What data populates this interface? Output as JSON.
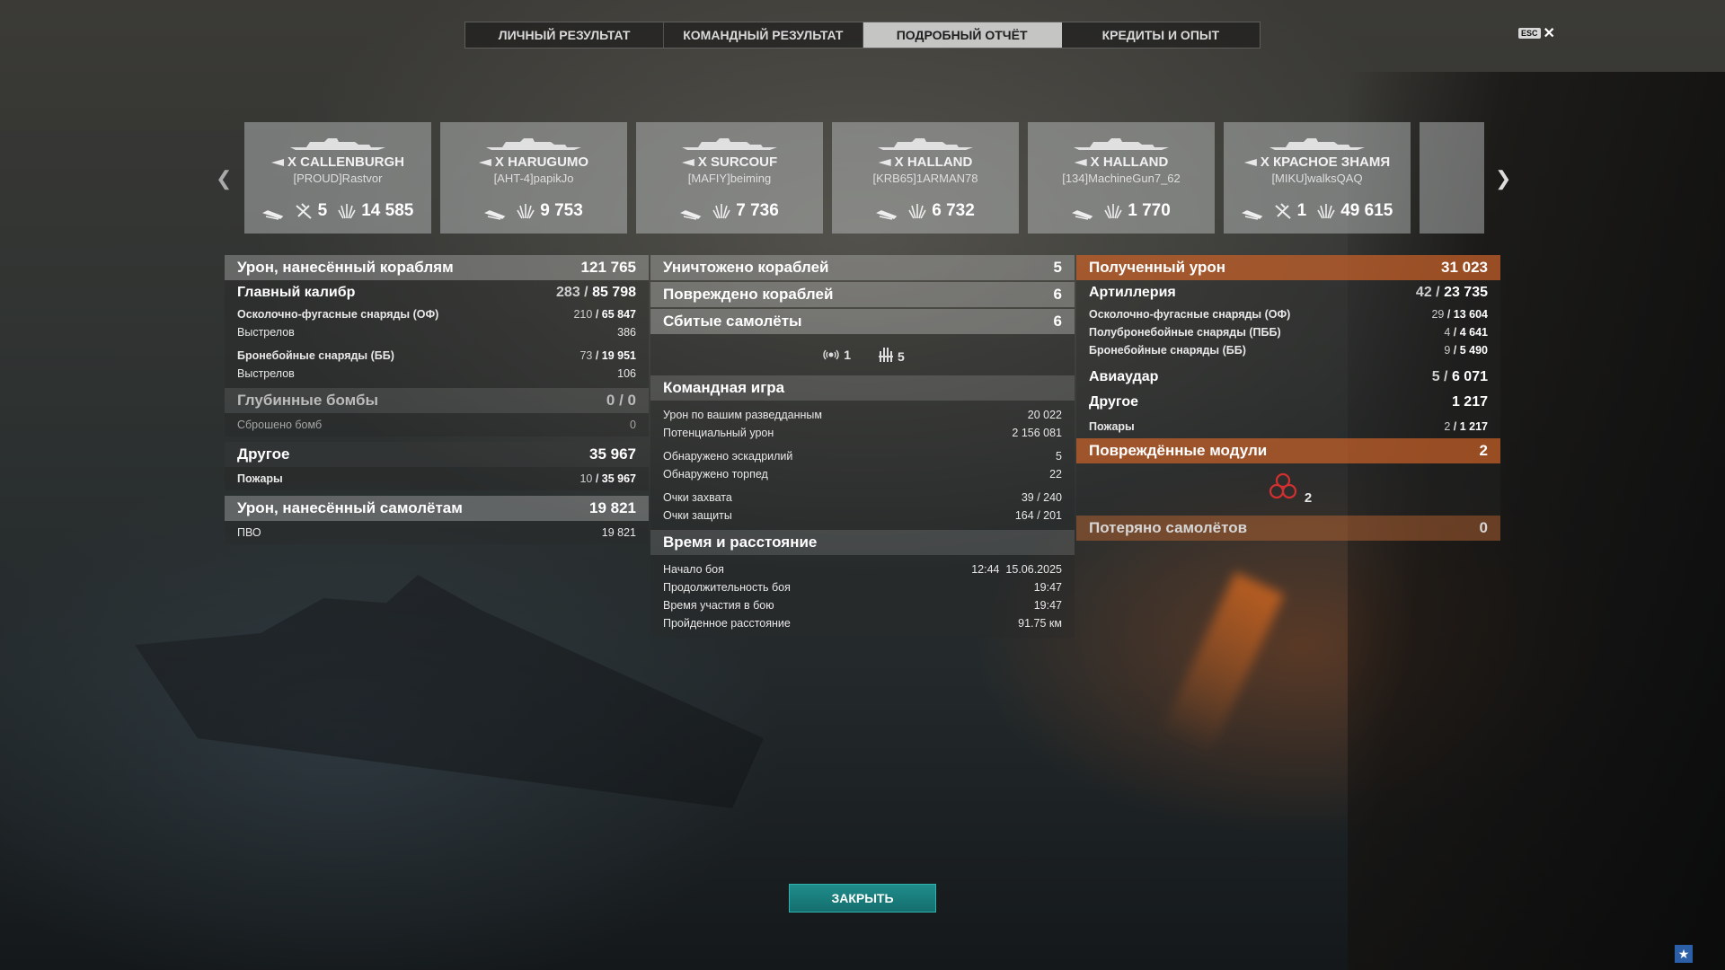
{
  "tabs": [
    {
      "label": "ЛИЧНЫЙ РЕЗУЛЬТАТ",
      "active": false
    },
    {
      "label": "КОМАНДНЫЙ РЕЗУЛЬТАТ",
      "active": false
    },
    {
      "label": "ПОДРОБНЫЙ ОТЧЁТ",
      "active": true
    },
    {
      "label": "КРЕДИТЫ И ОПЫТ",
      "active": false
    }
  ],
  "esc": {
    "key": "ESC",
    "close_glyph": "✕"
  },
  "cards": [
    {
      "ship": "X CALLENBURGH",
      "player": "[PROUD]Rastvor",
      "planes": "5",
      "damage": "14 585",
      "double_flag": true
    },
    {
      "ship": "X HARUGUMO",
      "player": "[AHT-4]papikJo",
      "planes": "",
      "damage": "9 753",
      "double_flag": false
    },
    {
      "ship": "X SURCOUF",
      "player": "[MAFIY]beiming",
      "planes": "",
      "damage": "7 736",
      "double_flag": false
    },
    {
      "ship": "X HALLAND",
      "player": "[KRB65]1ARMAN78",
      "planes": "",
      "damage": "6 732",
      "double_flag": false
    },
    {
      "ship": "X HALLAND",
      "player": "[134]MachineGun7_62",
      "planes": "",
      "damage": "1 770",
      "double_flag": false
    },
    {
      "ship": "X КРАСНОЕ ЗНАМЯ",
      "player": "[MIKU]walksQAQ",
      "planes": "1",
      "damage": "49 615",
      "double_flag": true
    }
  ],
  "col1": {
    "ship_damage": {
      "label": "Урон, нанесённый кораблям",
      "value": "121 765"
    },
    "main_battery": {
      "label": "Главный калибр",
      "hits": "283",
      "damage": "85 798"
    },
    "he": {
      "label": "Осколочно-фугасные снаряды (ОФ)",
      "hits": "210",
      "damage": "65 847"
    },
    "he_shots": {
      "label": "Выстрелов",
      "value": "386"
    },
    "ap": {
      "label": "Бронебойные снаряды (ББ)",
      "hits": "73",
      "damage": "19 951"
    },
    "ap_shots": {
      "label": "Выстрелов",
      "value": "106"
    },
    "depth": {
      "label": "Глубинные бомбы",
      "a": "0",
      "b": "0"
    },
    "dropped": {
      "label": "Сброшено бомб",
      "value": "0"
    },
    "other": {
      "label": "Другое",
      "value": "35 967"
    },
    "fires": {
      "label": "Пожары",
      "a": "10",
      "b": "35 967"
    },
    "aircraft_damage": {
      "label": "Урон, нанесённый самолётам",
      "value": "19 821"
    },
    "aa": {
      "label": "ПВО",
      "value": "19 821"
    }
  },
  "col2": {
    "destroyed": {
      "label": "Уничтожено кораблей",
      "value": "5"
    },
    "damaged": {
      "label": "Повреждено кораблей",
      "value": "6"
    },
    "planes_shot": {
      "label": "Сбитые самолёты",
      "value": "6"
    },
    "planes_icons": {
      "fighter_count": "1",
      "aa_count": "5"
    },
    "team": {
      "label": "Командная игра"
    },
    "spotting_dmg": {
      "label": "Урон по вашим разведданным",
      "value": "20 022"
    },
    "potential": {
      "label": "Потенциальный урон",
      "value": "2 156 081"
    },
    "squadrons": {
      "label": "Обнаружено эскадрилий",
      "value": "5"
    },
    "torpedoes": {
      "label": "Обнаружено торпед",
      "value": "22"
    },
    "capture": {
      "label": "Очки захвата",
      "value": "39 / 240"
    },
    "defense": {
      "label": "Очки защиты",
      "value": "164 / 201"
    },
    "time": {
      "label": "Время и расстояние"
    },
    "start": {
      "label": "Начало боя",
      "value": "12:44  15.06.2025"
    },
    "duration": {
      "label": "Продолжительность боя",
      "value": "19:47"
    },
    "participation": {
      "label": "Время участия в бою",
      "value": "19:47"
    },
    "distance": {
      "label": "Пройденное расстояние",
      "value": "91.75 км"
    }
  },
  "col3": {
    "received": {
      "label": "Полученный урон",
      "value": "31 023"
    },
    "artillery": {
      "label": "Артиллерия",
      "hits": "42",
      "damage": "23 735"
    },
    "he": {
      "label": "Осколочно-фугасные снаряды (ОФ)",
      "hits": "29",
      "damage": "13 604"
    },
    "sap": {
      "label": "Полубронебойные снаряды (ПББ)",
      "hits": "4",
      "damage": "4 641"
    },
    "ap": {
      "label": "Бронебойные снаряды (ББ)",
      "hits": "9",
      "damage": "5 490"
    },
    "airstrike": {
      "label": "Авиаудар",
      "hits": "5",
      "damage": "6 071"
    },
    "other": {
      "label": "Другое",
      "value": "1 217"
    },
    "fires": {
      "label": "Пожары",
      "hits": "2",
      "damage": "1 217"
    },
    "modules": {
      "label": "Повреждённые модули",
      "value": "2",
      "icon_count": "2"
    },
    "planes_lost": {
      "label": "Потеряно самолётов",
      "value": "0"
    }
  },
  "close": "ЗАКРЫТЬ",
  "colors": {
    "accent_teal": "#1f8d8b",
    "orange_header": "#c35f28",
    "module_red": "#d23030"
  }
}
